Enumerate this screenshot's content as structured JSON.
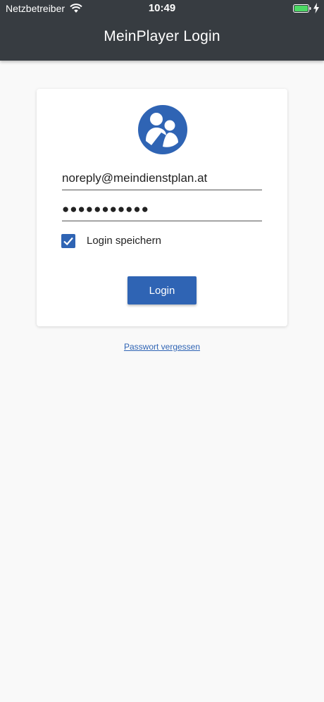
{
  "status_bar": {
    "carrier": "Netzbetreiber",
    "time": "10:49",
    "icons": [
      "wifi-icon",
      "battery-icon",
      "charging-icon"
    ]
  },
  "header": {
    "title": "MeinPlayer Login"
  },
  "login_form": {
    "logo_icon": "people-icon",
    "email_value": "noreply@meindienstplan.at",
    "password_value": "●●●●●●●●●●●",
    "remember_label": "Login speichern",
    "remember_checked": true,
    "login_label": "Login"
  },
  "forgot_password_label": "Passwort vergessen",
  "colors": {
    "header_bg": "#373c41",
    "accent": "#2f64b4",
    "page_bg": "#f9f9f9",
    "battery": "#4cd964"
  }
}
